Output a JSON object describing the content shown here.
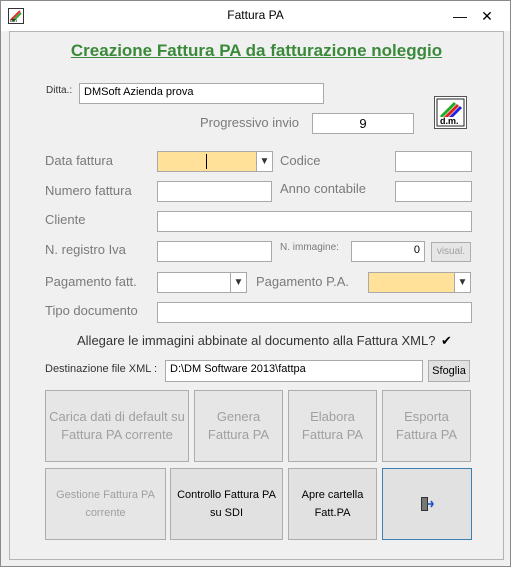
{
  "window": {
    "title": "Fattura PA"
  },
  "controls": {
    "minimize": "—",
    "close": "✕"
  },
  "heading": "Creazione Fattura PA da fatturazione noleggio",
  "ditta": {
    "label": "Ditta.:",
    "value": "DMSoft Azienda prova"
  },
  "progressivo": {
    "label": "Progressivo invio",
    "value": "9"
  },
  "logo_text": "d.m.",
  "form": {
    "data_fattura": "Data fattura",
    "codice": "Codice",
    "numero_fattura": "Numero fattura",
    "anno_contabile": "Anno contabile",
    "cliente": "Cliente",
    "n_registro_iva": "N. registro Iva",
    "n_immagine": "N. immagine:",
    "n_immagine_value": "0",
    "visual": "visual.",
    "pagamento_fatt": "Pagamento fatt.",
    "pagamento_pa": "Pagamento P.A.",
    "tipo_documento": "Tipo documento",
    "allegare": "Allegare le immagini abbinate al documento alla Fattura XML?",
    "allegare_checked": "✔",
    "destinazione_label": "Destinazione file XML :",
    "destinazione_value": "D:\\DM Software 2013\\fattpa",
    "sfoglia": "Sfoglia"
  },
  "buttons": {
    "carica": "Carica dati di default su  Fattura PA corrente",
    "genera": "Genera Fattura PA",
    "elabora": "Elabora Fattura PA",
    "esporta": "Esporta Fattura PA",
    "gestione": "Gestione Fattura PA corrente",
    "controllo": "Controllo Fattura PA su SDI",
    "apre": "Apre cartella Fatt.PA",
    "exit_icon": "exit-door-icon"
  },
  "colors": {
    "heading": "#3b8a3b",
    "highlight": "#ffe19a"
  }
}
